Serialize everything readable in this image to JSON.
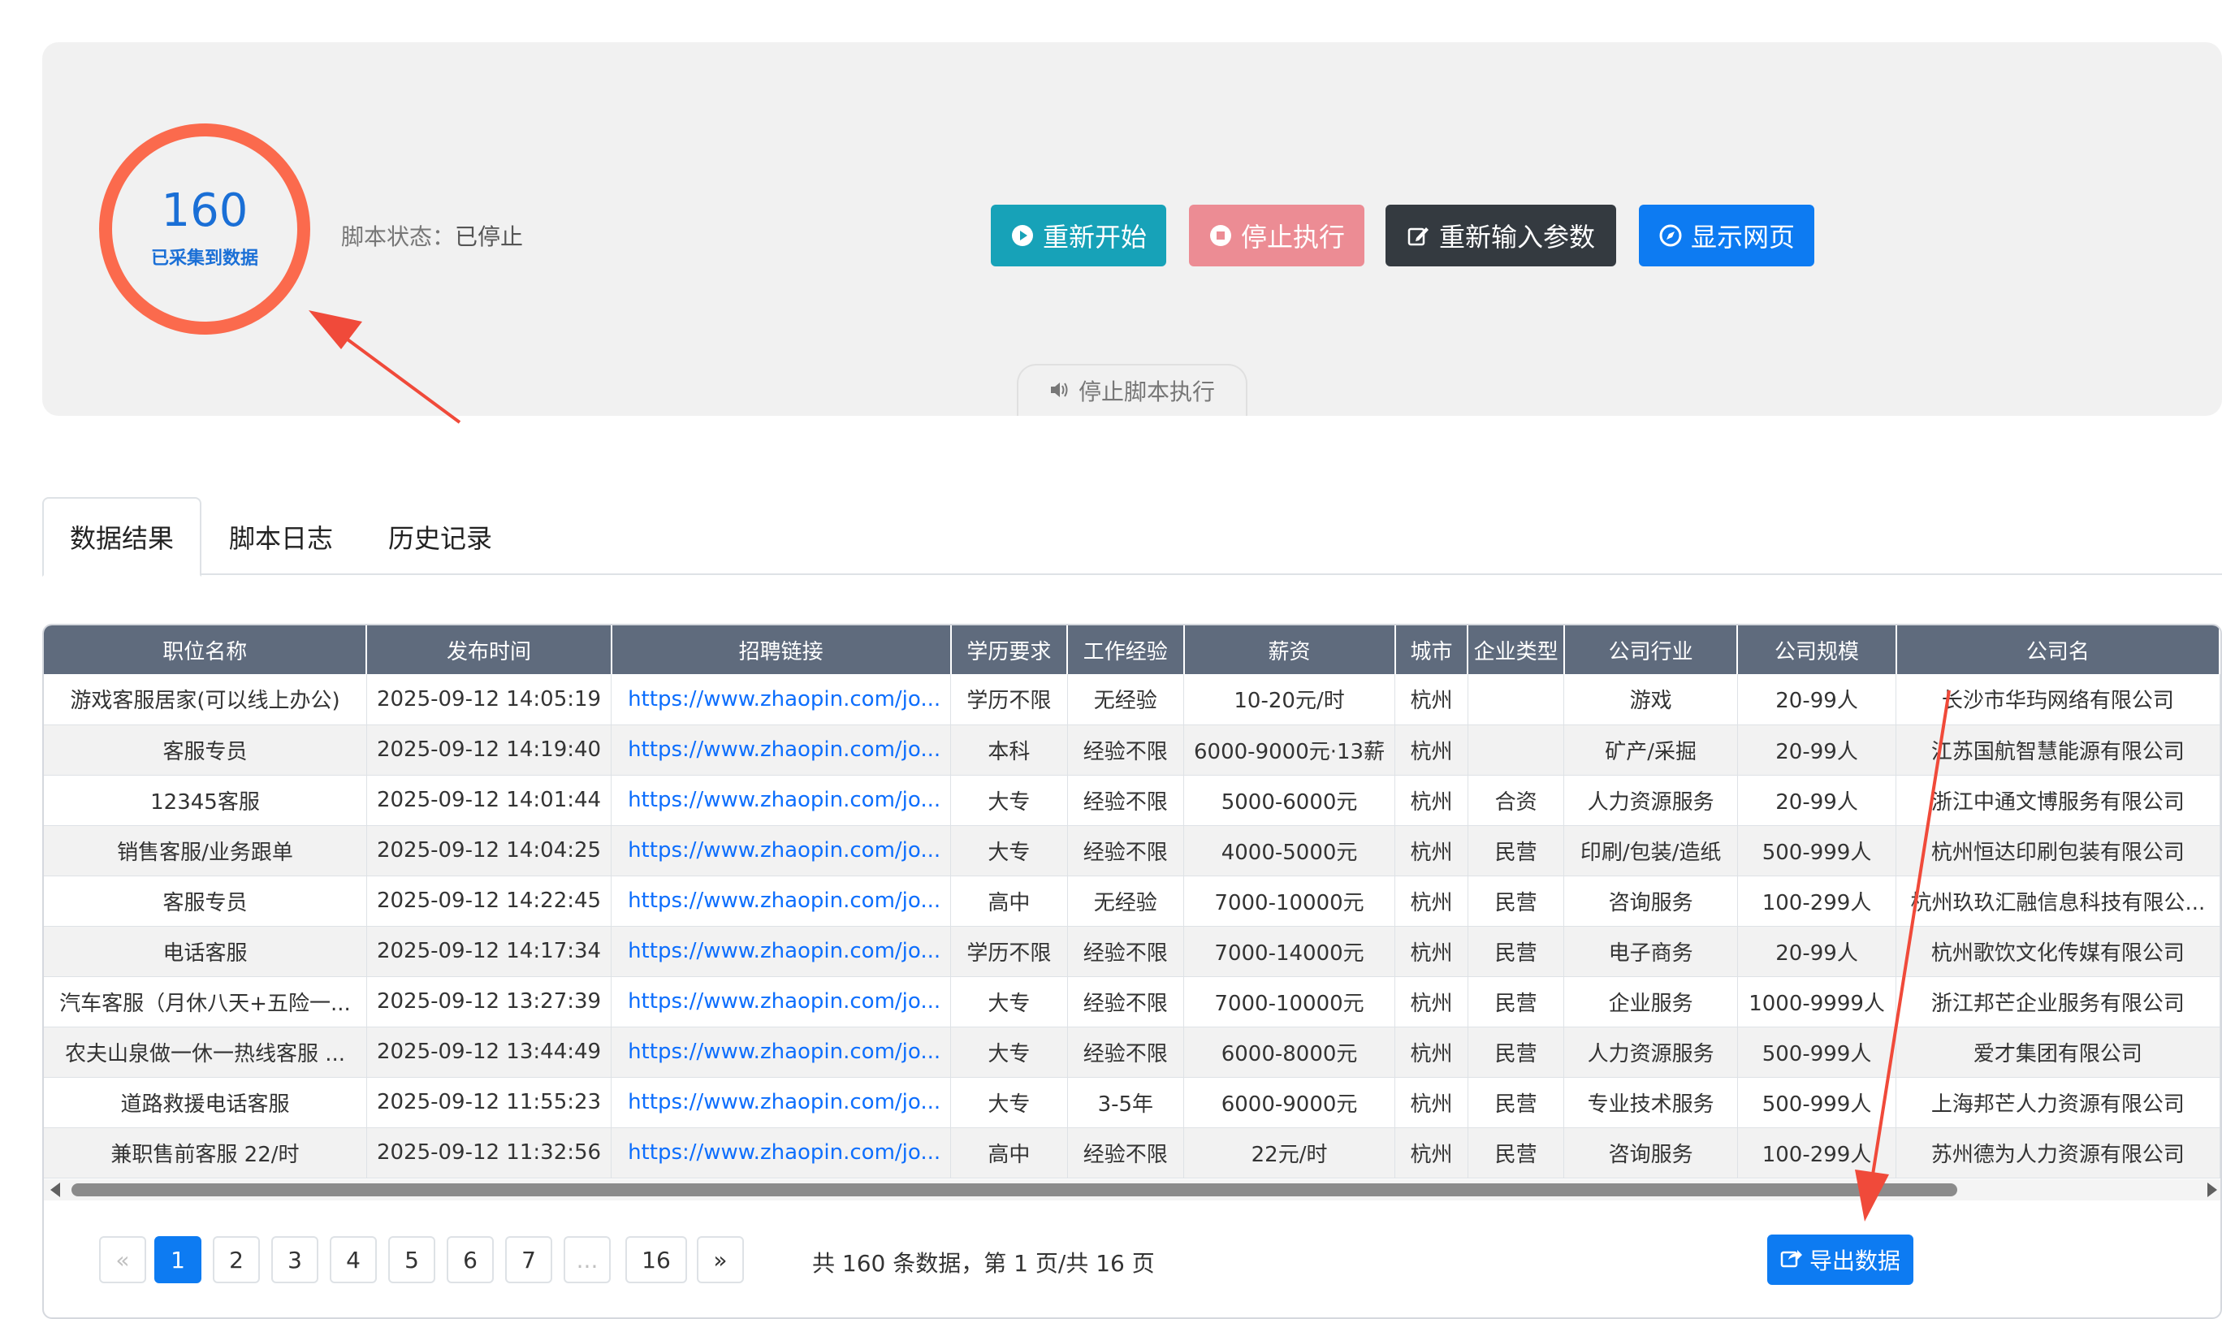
{
  "counter": {
    "value": "160",
    "label": "已采集到数据"
  },
  "script_status": {
    "label": "脚本状态：",
    "value": "已停止"
  },
  "buttons": {
    "restart": "重新开始",
    "stop": "停止执行",
    "reinput": "重新输入参数",
    "show_page": "显示网页"
  },
  "notice_tab": {
    "label": "停止脚本执行"
  },
  "tabs": [
    {
      "label": "数据结果",
      "active": true
    },
    {
      "label": "脚本日志",
      "active": false
    },
    {
      "label": "历史记录",
      "active": false
    }
  ],
  "table": {
    "columns": [
      "职位名称",
      "发布时间",
      "招聘链接",
      "学历要求",
      "工作经验",
      "薪资",
      "城市",
      "企业类型",
      "公司行业",
      "公司规模",
      "公司名"
    ],
    "rows": [
      [
        "游戏客服居家(可以线上办公)",
        "2025-09-12 14:05:19",
        "https://www.zhaopin.com/jo...",
        "学历不限",
        "无经验",
        "10-20元/时",
        "杭州",
        "",
        "游戏",
        "20-99人",
        "长沙市华玙网络有限公司"
      ],
      [
        "客服专员",
        "2025-09-12 14:19:40",
        "https://www.zhaopin.com/jo...",
        "本科",
        "经验不限",
        "6000-9000元·13薪",
        "杭州",
        "",
        "矿产/采掘",
        "20-99人",
        "江苏国航智慧能源有限公司"
      ],
      [
        "12345客服",
        "2025-09-12 14:01:44",
        "https://www.zhaopin.com/jo...",
        "大专",
        "经验不限",
        "5000-6000元",
        "杭州",
        "合资",
        "人力资源服务",
        "20-99人",
        "浙江中通文博服务有限公司"
      ],
      [
        "销售客服/业务跟单",
        "2025-09-12 14:04:25",
        "https://www.zhaopin.com/jo...",
        "大专",
        "经验不限",
        "4000-5000元",
        "杭州",
        "民营",
        "印刷/包装/造纸",
        "500-999人",
        "杭州恒达印刷包装有限公司"
      ],
      [
        "客服专员",
        "2025-09-12 14:22:45",
        "https://www.zhaopin.com/jo...",
        "高中",
        "无经验",
        "7000-10000元",
        "杭州",
        "民营",
        "咨询服务",
        "100-299人",
        "杭州玖玖汇融信息科技有限公..."
      ],
      [
        "电话客服",
        "2025-09-12 14:17:34",
        "https://www.zhaopin.com/jo...",
        "学历不限",
        "经验不限",
        "7000-14000元",
        "杭州",
        "民营",
        "电子商务",
        "20-99人",
        "杭州歌饮文化传媒有限公司"
      ],
      [
        "汽车客服（月休八天+五险一...",
        "2025-09-12 13:27:39",
        "https://www.zhaopin.com/jo...",
        "大专",
        "经验不限",
        "7000-10000元",
        "杭州",
        "民营",
        "企业服务",
        "1000-9999人",
        "浙江邦芒企业服务有限公司"
      ],
      [
        "农夫山泉做一休一热线客服 ...",
        "2025-09-12 13:44:49",
        "https://www.zhaopin.com/jo...",
        "大专",
        "经验不限",
        "6000-8000元",
        "杭州",
        "民营",
        "人力资源服务",
        "500-999人",
        "爱才集团有限公司"
      ],
      [
        "道路救援电话客服",
        "2025-09-12 11:55:23",
        "https://www.zhaopin.com/jo...",
        "大专",
        "3-5年",
        "6000-9000元",
        "杭州",
        "民营",
        "专业技术服务",
        "500-999人",
        "上海邦芒人力资源有限公司"
      ],
      [
        "兼职售前客服 22/时",
        "2025-09-12 11:32:56",
        "https://www.zhaopin.com/jo...",
        "高中",
        "经验不限",
        "22元/时",
        "杭州",
        "民营",
        "咨询服务",
        "100-299人",
        "苏州德为人力资源有限公司"
      ]
    ]
  },
  "pagination": {
    "prev": "«",
    "next": "»",
    "pages": [
      "1",
      "2",
      "3",
      "4",
      "5",
      "6",
      "7",
      "...",
      "16"
    ],
    "current": "1",
    "info": "共 160 条数据，第 1 页/共 16 页"
  },
  "export_button": "导出数据",
  "icons": {
    "restart": "play-circle-icon",
    "stop": "stop-circle-icon",
    "reinput": "edit-icon",
    "show_page": "compass-icon",
    "notice": "volume-icon",
    "export": "share-icon"
  },
  "colors": {
    "ring": "#fb6a4d",
    "restart": "#17a2b8",
    "stop": "#ec8c94",
    "reinput": "#343a40",
    "primary": "#0d7bf2",
    "table_header": "#5f6b7d",
    "annotation_arrow": "#f04a3a"
  }
}
